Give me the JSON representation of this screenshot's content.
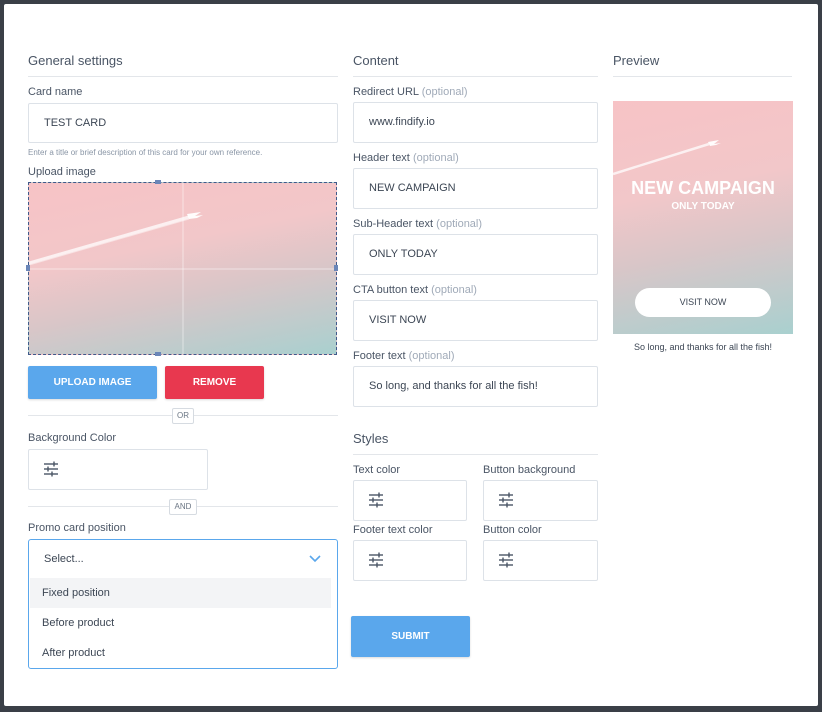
{
  "general": {
    "title": "General settings",
    "card_name_label": "Card name",
    "card_name_value": "TEST CARD",
    "card_name_hint": "Enter a title or brief description of this card for your own reference.",
    "upload_label": "Upload image",
    "upload_button": "UPLOAD IMAGE",
    "remove_button": "REMOVE",
    "or_label": "OR",
    "bg_color_label": "Background Color",
    "and_label": "AND",
    "position_label": "Promo card position",
    "position_placeholder": "Select...",
    "position_options": [
      "Fixed position",
      "Before product",
      "After product"
    ]
  },
  "content": {
    "title": "Content",
    "optional": "(optional)",
    "redirect_label": "Redirect URL",
    "redirect_value": "www.findify.io",
    "header_label": "Header text",
    "header_value": "NEW CAMPAIGN",
    "subheader_label": "Sub-Header text",
    "subheader_value": "ONLY TODAY",
    "cta_label": "CTA button text",
    "cta_value": "VISIT NOW",
    "footer_label": "Footer text",
    "footer_value": "So long, and thanks for all the fish!"
  },
  "styles": {
    "title": "Styles",
    "text_color_label": "Text color",
    "button_bg_label": "Button background",
    "footer_color_label": "Footer text color",
    "button_color_label": "Button color"
  },
  "submit_button": "SUBMIT",
  "preview": {
    "title": "Preview",
    "header": "NEW CAMPAIGN",
    "subheader": "ONLY TODAY",
    "cta": "VISIT NOW",
    "footer": "So long, and thanks for all the fish!"
  },
  "colors": {
    "upload_button": "#5aa7ec",
    "remove_button": "#e8384f",
    "submit_button": "#5aa7ec",
    "dropdown_border": "#5aa7ec"
  }
}
